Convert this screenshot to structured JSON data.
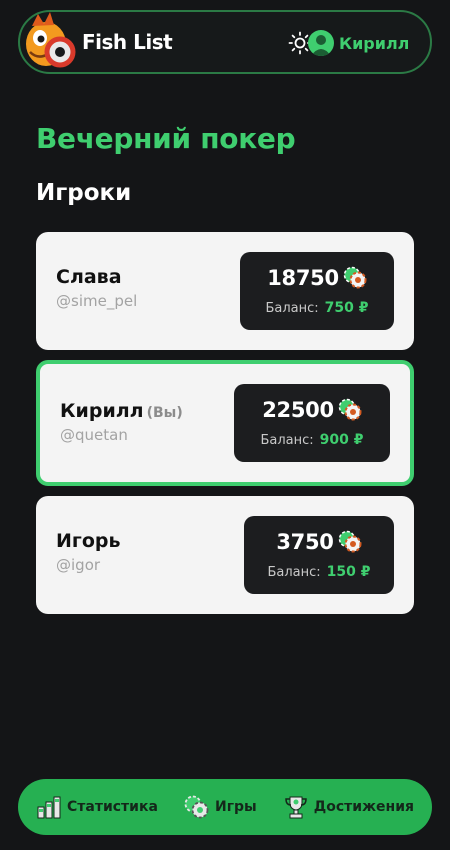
{
  "header": {
    "app_title": "Fish List",
    "user_name": "Кирилл"
  },
  "page_title": "Вечерний покер",
  "section_title": "Игроки",
  "players": [
    {
      "name": "Слава",
      "you_tag": "",
      "handle": "@sime_pel",
      "chips": "18750",
      "balance_label": "Баланс:",
      "balance": "750 ₽",
      "is_me": false
    },
    {
      "name": "Кирилл",
      "you_tag": "(Вы)",
      "handle": "@quetan",
      "chips": "22500",
      "balance_label": "Баланс:",
      "balance": "900 ₽",
      "is_me": true
    },
    {
      "name": "Игорь",
      "you_tag": "",
      "handle": "@igor",
      "chips": "3750",
      "balance_label": "Баланс:",
      "balance": "150 ₽",
      "is_me": false
    }
  ],
  "bottom_nav": {
    "items": [
      {
        "label": "Статистика",
        "icon": "statistics-icon"
      },
      {
        "label": "Игры",
        "icon": "poker-chips-icon"
      },
      {
        "label": "Достижения",
        "icon": "trophy-icon"
      }
    ]
  },
  "colors": {
    "background": "#141517",
    "accent_green": "#3fce6f",
    "nav_green": "#26b052",
    "card_bg": "#f4f4f4",
    "stack_box_bg": "#1c1d1f"
  }
}
